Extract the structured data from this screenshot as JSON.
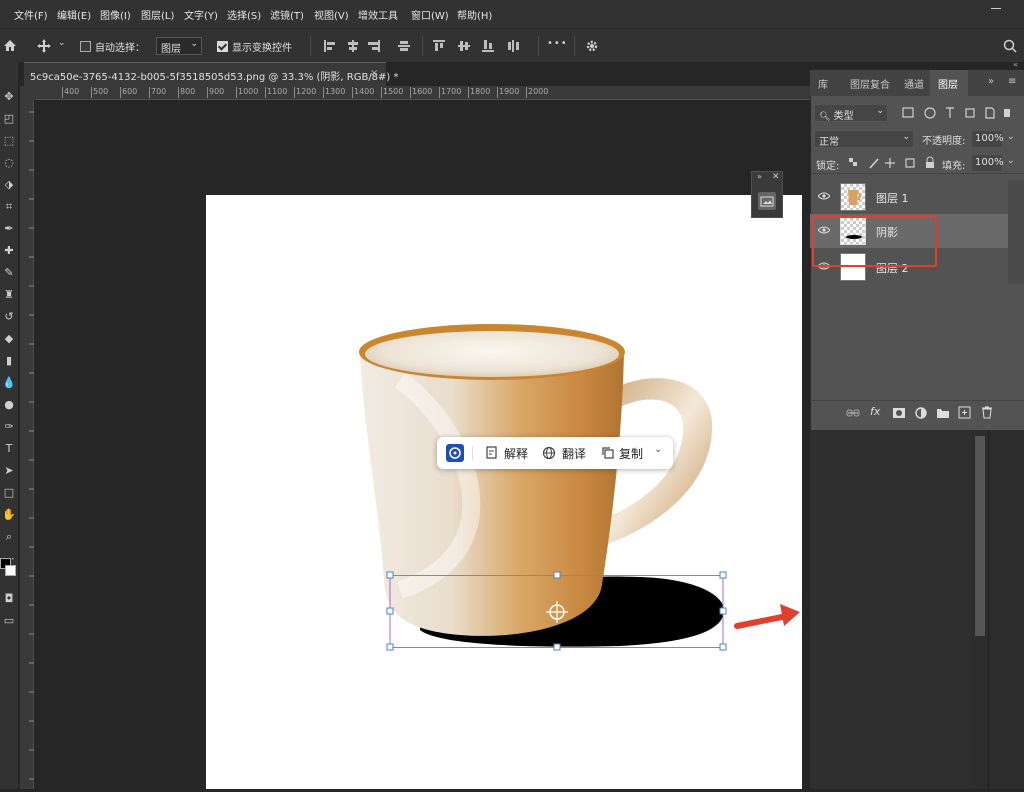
{
  "menu": [
    "文件(F)",
    "编辑(E)",
    "图像(I)",
    "图层(L)",
    "文字(Y)",
    "选择(S)",
    "滤镜(T)",
    "视图(V)",
    "增效工具",
    "窗口(W)",
    "帮助(H)"
  ],
  "options": {
    "auto_select_label": "自动选择：",
    "auto_select_value": "图层",
    "show_transform_label": "显示变换控件",
    "more_label": "•••"
  },
  "document": {
    "tab_title": "5c9ca50e-3765-4132-b005-5f3518505d53.png @ 33.3% (阴影, RGB/8#) *",
    "close": "×"
  },
  "ruler": {
    "h_ticks": [
      "400",
      "500",
      "600",
      "700",
      "800",
      "900",
      "1000",
      "1100",
      "1200",
      "1300",
      "1400",
      "1500",
      "1600",
      "1700",
      "1800",
      "1900",
      "2000"
    ]
  },
  "popup": {
    "explain": "解释",
    "translate": "翻译",
    "copy": "复制"
  },
  "layers_panel": {
    "tabs": [
      "库",
      "图层复合",
      "通道",
      "图层"
    ],
    "active_tab": "图层",
    "filter_kind": "类型",
    "blend_mode": "正常",
    "opacity_label": "不透明度:",
    "opacity_value": "100%",
    "lock_label": "锁定:",
    "fill_label": "填充:",
    "fill_value": "100%",
    "layers": [
      {
        "name": "图层 1",
        "selected": false
      },
      {
        "name": "阴影",
        "selected": true
      },
      {
        "name": "图层 2",
        "selected": false
      }
    ],
    "footer_fx": "fx"
  },
  "colors": {
    "highlight_box": "#e0412e",
    "arrow": "#e0412e",
    "selection_outline": "#a66bd8"
  }
}
